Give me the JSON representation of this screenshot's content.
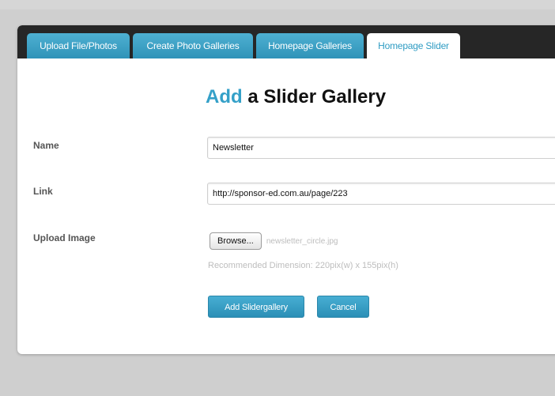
{
  "tabs": [
    {
      "label": "Upload File/Photos",
      "active": false
    },
    {
      "label": "Create Photo Galleries",
      "active": false
    },
    {
      "label": "Homepage Galleries",
      "active": false
    },
    {
      "label": "Homepage Slider",
      "active": true
    }
  ],
  "heading": {
    "accent": "Add",
    "rest": " a Slider Gallery"
  },
  "form": {
    "name_label": "Name",
    "name_value": "Newsletter",
    "link_label": "Link",
    "link_value": "http://sponsor-ed.com.au/page/223",
    "upload_label": "Upload Image",
    "browse_label": "Browse...",
    "file_name": "newsletter_circle.jpg",
    "hint": "Recommended Dimension: 220pix(w) x 155pix(h)",
    "submit_label": "Add Slidergallery",
    "cancel_label": "Cancel"
  },
  "colors": {
    "accent": "#34a0c8",
    "tab_bar": "#262626",
    "button": "#2f93b8"
  }
}
